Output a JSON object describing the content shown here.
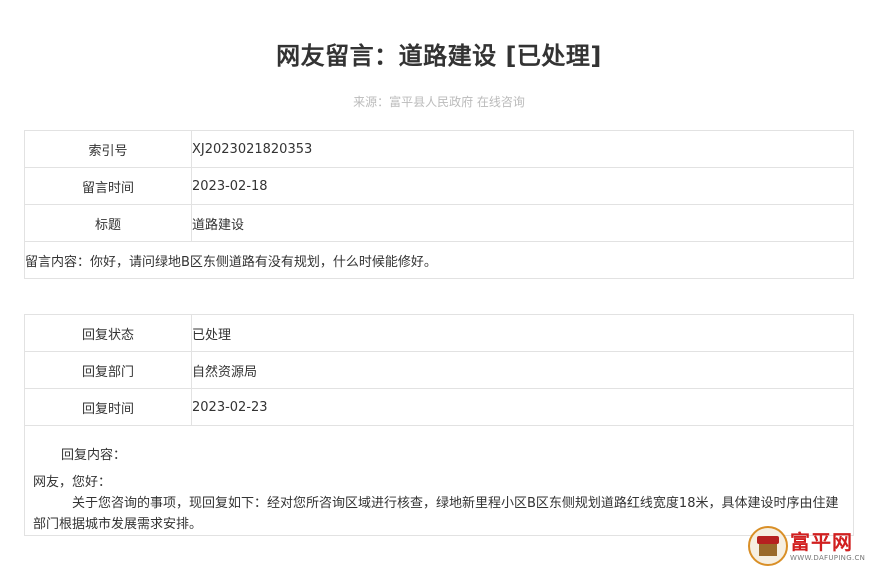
{
  "page": {
    "title": "网友留言：道路建设 [已处理]",
    "source": "来源：富平县人民政府 在线咨询"
  },
  "message": {
    "rows": [
      {
        "label": "索引号",
        "value": "XJ2023021820353"
      },
      {
        "label": "留言时间",
        "value": "2023-02-18"
      },
      {
        "label": "标题",
        "value": "道路建设"
      }
    ],
    "content": "留言内容：你好，请问绿地B区东侧道路有没有规划，什么时候能修好。"
  },
  "reply": {
    "rows": [
      {
        "label": "回复状态",
        "value": "已处理"
      },
      {
        "label": "回复部门",
        "value": "自然资源局"
      },
      {
        "label": "回复时间",
        "value": "2023-02-23"
      }
    ],
    "content_label": "回复内容：",
    "greeting": "网友，您好：",
    "body": "关于您咨询的事项，现回复如下：经对您所咨询区域进行核查，绿地新里程小区B区东侧规划道路红线宽度18米，具体建设时序由住建部门根据城市发展需求安排。"
  },
  "watermark": {
    "icon": "city-gate-icon",
    "text": "富平网",
    "url": "WWW.DAFUPING.CN"
  }
}
